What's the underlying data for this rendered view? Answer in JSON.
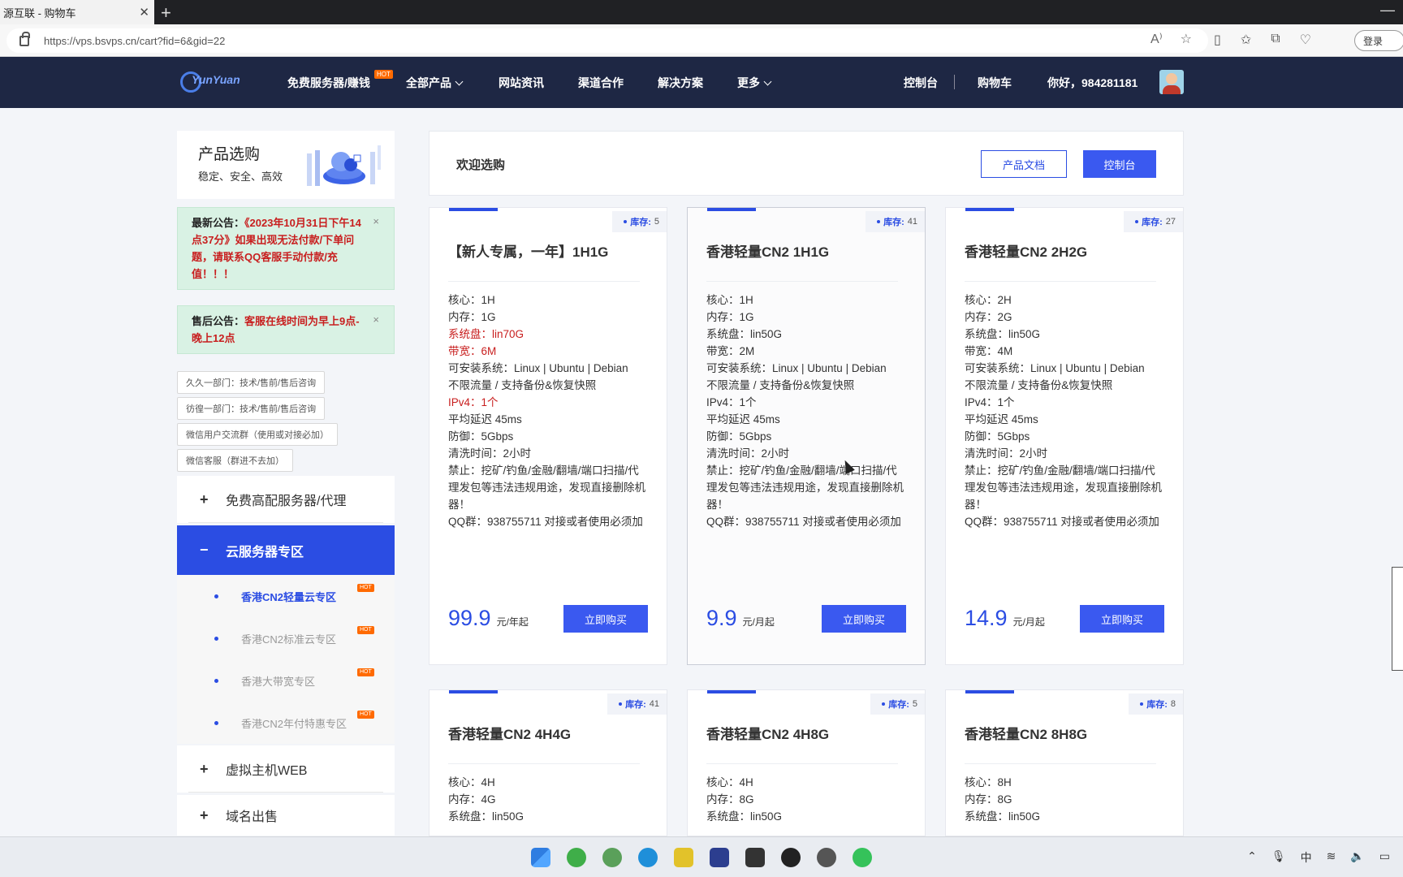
{
  "browser": {
    "tab_title": "源互联 - 购物车",
    "url": "https://vps.bsvps.cn/cart?fid=6&gid=22",
    "login_label": "登录"
  },
  "site": {
    "logo_text": "YunYuan",
    "nav": [
      {
        "label": "免费服务器/赚钱",
        "badge": "HOT"
      },
      {
        "label": "全部产品"
      },
      {
        "label": "网站资讯"
      },
      {
        "label": "渠道合作"
      },
      {
        "label": "解决方案"
      },
      {
        "label": "更多"
      }
    ],
    "console_label": "控制台",
    "cart_label": "购物车",
    "greeting": "你好，",
    "username": "984281181"
  },
  "sidebar": {
    "promo_title": "产品选购",
    "promo_subtitle": "稳定、安全、高效",
    "notice1_label": "最新公告：",
    "notice1_text": "《2023年10月31日下午14点37分》如果出现无法付款/下单问题，请联系QQ客服手动付款/充值！！！",
    "notice2_label": "售后公告：",
    "notice2_text": "客服在线时间为早上9点-晚上12点",
    "close_glyph": "×",
    "depts": [
      "久久一部门：技术/售前/售后咨询",
      "彷徨一部门：技术/售前/售后咨询",
      "微信用户交流群（使用或对接必加）",
      "微信客服（群进不去加）"
    ],
    "menu": [
      {
        "sign": "+",
        "label": "免费高配服务器/代理"
      },
      {
        "sign": "−",
        "label": "云服务器专区"
      }
    ],
    "submenu": [
      {
        "label": "香港CN2轻量云专区",
        "badge": "HOT"
      },
      {
        "label": "香港CN2标准云专区",
        "badge": "HOT"
      },
      {
        "label": "香港大带宽专区",
        "badge": "HOT"
      },
      {
        "label": "香港CN2年付特惠专区",
        "badge": "HOT"
      }
    ],
    "menu_bottom": [
      {
        "sign": "+",
        "label": "虚拟主机WEB"
      },
      {
        "sign": "+",
        "label": "域名出售"
      }
    ]
  },
  "main": {
    "welcome": "欢迎选购",
    "docs_button": "产品文档",
    "console_button": "控制台",
    "stock_label": "库存:",
    "buy_label": "立即购买",
    "products": [
      {
        "name": "【新人专属，一年】1H1G",
        "stock": "5",
        "specs": [
          {
            "text": "核心：1H",
            "red": false
          },
          {
            "text": "内存：1G",
            "red": false
          },
          {
            "text": "系统盘：lin70G",
            "red": true
          },
          {
            "text": "带宽：6M",
            "red": true
          },
          {
            "text": "可安装系统：Linux | Ubuntu | Debian",
            "red": false
          },
          {
            "text": "不限流量 / 支持备份&恢复快照",
            "red": false
          },
          {
            "text": "IPv4：1个",
            "red": true
          },
          {
            "text": "平均延迟 45ms",
            "red": false
          },
          {
            "text": "防御：5Gbps",
            "red": false
          },
          {
            "text": "清洗时间：2小时",
            "red": false
          },
          {
            "text": "禁止：挖矿/钓鱼/金融/翻墙/端口扫描/代理发包等违法违规用途，发现直接删除机器！",
            "red": false
          },
          {
            "text": "QQ群：938755711 对接或者使用必须加",
            "red": false
          }
        ],
        "price": "99.9",
        "unit": "元/年起"
      },
      {
        "name": "香港轻量CN2 1H1G",
        "stock": "41",
        "specs": [
          {
            "text": "核心：1H",
            "red": false
          },
          {
            "text": "内存：1G",
            "red": false
          },
          {
            "text": "系统盘：lin50G",
            "red": false
          },
          {
            "text": "带宽：2M",
            "red": false
          },
          {
            "text": "可安装系统：Linux | Ubuntu | Debian",
            "red": false
          },
          {
            "text": "不限流量 / 支持备份&恢复快照",
            "red": false
          },
          {
            "text": "IPv4：1个",
            "red": false
          },
          {
            "text": "平均延迟 45ms",
            "red": false
          },
          {
            "text": "防御：5Gbps",
            "red": false
          },
          {
            "text": "清洗时间：2小时",
            "red": false
          },
          {
            "text": "禁止：挖矿/钓鱼/金融/翻墙/端口扫描/代理发包等违法违规用途，发现直接删除机器！",
            "red": false
          },
          {
            "text": "QQ群：938755711 对接或者使用必须加",
            "red": false
          }
        ],
        "price": "9.9",
        "unit": "元/月起"
      },
      {
        "name": "香港轻量CN2 2H2G",
        "stock": "27",
        "specs": [
          {
            "text": "核心：2H",
            "red": false
          },
          {
            "text": "内存：2G",
            "red": false
          },
          {
            "text": "系统盘：lin50G",
            "red": false
          },
          {
            "text": "带宽：4M",
            "red": false
          },
          {
            "text": "可安装系统：Linux | Ubuntu | Debian",
            "red": false
          },
          {
            "text": "不限流量 / 支持备份&恢复快照",
            "red": false
          },
          {
            "text": "IPv4：1个",
            "red": false
          },
          {
            "text": "平均延迟 45ms",
            "red": false
          },
          {
            "text": "防御：5Gbps",
            "red": false
          },
          {
            "text": "清洗时间：2小时",
            "red": false
          },
          {
            "text": "禁止：挖矿/钓鱼/金融/翻墙/端口扫描/代理发包等违法违规用途，发现直接删除机器！",
            "red": false
          },
          {
            "text": "QQ群：938755711 对接或者使用必须加",
            "red": false
          }
        ],
        "price": "14.9",
        "unit": "元/月起"
      },
      {
        "name": "香港轻量CN2 4H4G",
        "stock": "41",
        "specs": [
          {
            "text": "核心：4H",
            "red": false
          },
          {
            "text": "内存：4G",
            "red": false
          },
          {
            "text": "系统盘：lin50G",
            "red": false
          }
        ]
      },
      {
        "name": "香港轻量CN2 4H8G",
        "stock": "5",
        "specs": [
          {
            "text": "核心：4H",
            "red": false
          },
          {
            "text": "内存：8G",
            "red": false
          },
          {
            "text": "系统盘：lin50G",
            "red": false
          }
        ]
      },
      {
        "name": "香港轻量CN2 8H8G",
        "stock": "8",
        "specs": [
          {
            "text": "核心：8H",
            "red": false
          },
          {
            "text": "内存：8G",
            "red": false
          },
          {
            "text": "系统盘：lin50G",
            "red": false
          }
        ]
      }
    ]
  },
  "colors": {
    "header_bg": "#1e2744",
    "accent": "#2b4de3",
    "notice_bg": "#d9f2e4",
    "danger": "#c81e1e",
    "hot": "#ff6a00"
  }
}
